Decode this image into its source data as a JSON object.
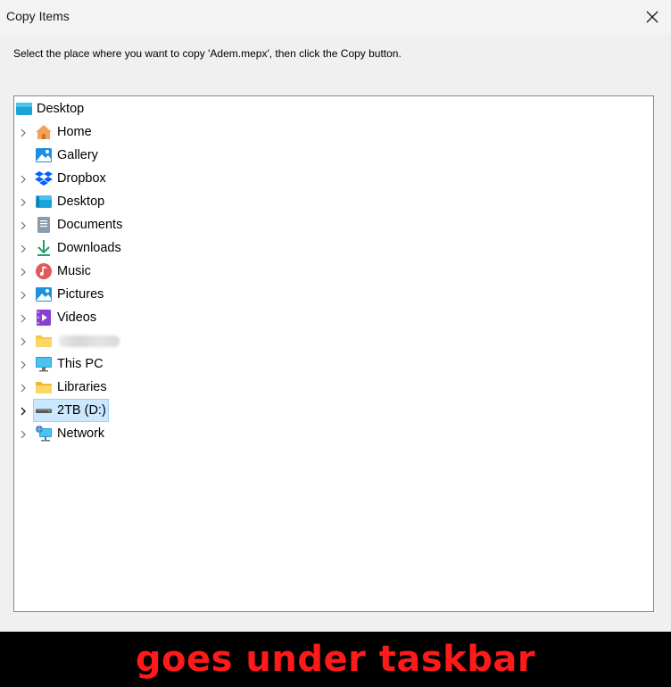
{
  "dialog": {
    "title": "Copy Items",
    "instruction": "Select the place where you want to copy 'Adem.mepx', then click the Copy button."
  },
  "tree": {
    "root": {
      "label": "Desktop",
      "icon": "desktop-icon"
    },
    "items": [
      {
        "label": "Home",
        "icon": "home-icon",
        "expandable": true
      },
      {
        "label": "Gallery",
        "icon": "gallery-icon",
        "expandable": false
      },
      {
        "label": "Dropbox",
        "icon": "dropbox-icon",
        "expandable": true
      },
      {
        "label": "Desktop",
        "icon": "desktop-icon",
        "expandable": true
      },
      {
        "label": "Documents",
        "icon": "documents-icon",
        "expandable": true
      },
      {
        "label": "Downloads",
        "icon": "downloads-icon",
        "expandable": true
      },
      {
        "label": "Music",
        "icon": "music-icon",
        "expandable": true
      },
      {
        "label": "Pictures",
        "icon": "pictures-icon",
        "expandable": true
      },
      {
        "label": "Videos",
        "icon": "videos-icon",
        "expandable": true
      },
      {
        "label": "",
        "icon": "folder-icon",
        "expandable": true,
        "redacted": true
      },
      {
        "label": "This PC",
        "icon": "this-pc-icon",
        "expandable": true
      },
      {
        "label": "Libraries",
        "icon": "libraries-icon",
        "expandable": true
      },
      {
        "label": "2TB (D:)",
        "icon": "drive-icon",
        "expandable": true,
        "selected": true
      },
      {
        "label": "Network",
        "icon": "network-icon",
        "expandable": true
      }
    ]
  },
  "overlay": {
    "text": "goes under taskbar",
    "color": "#ff1a1a"
  },
  "colors": {
    "selection_bg": "#cce8ff",
    "selection_border": "#99d1ff"
  }
}
